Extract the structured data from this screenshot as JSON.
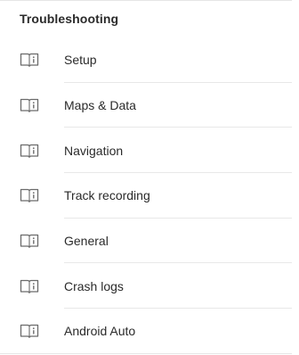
{
  "section": {
    "title": "Troubleshooting"
  },
  "items": [
    {
      "label": "Setup",
      "icon": "book-info-icon"
    },
    {
      "label": "Maps & Data",
      "icon": "book-info-icon"
    },
    {
      "label": "Navigation",
      "icon": "book-info-icon"
    },
    {
      "label": "Track recording",
      "icon": "book-info-icon"
    },
    {
      "label": "General",
      "icon": "book-info-icon"
    },
    {
      "label": "Crash logs",
      "icon": "book-info-icon"
    },
    {
      "label": "Android Auto",
      "icon": "book-info-icon"
    }
  ],
  "colors": {
    "text": "#2a2a2a",
    "icon": "#6b6b6b",
    "divider": "#e8e8e8"
  }
}
